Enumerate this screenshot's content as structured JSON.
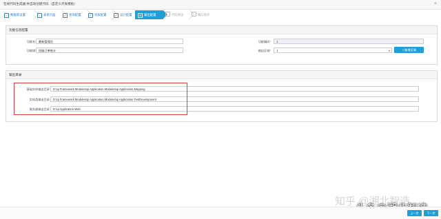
{
  "window": {
    "title": "在线代码生成器 并自动创建代码（自定义开发模板）",
    "close": "×"
  },
  "steps": [
    {
      "label": "数据库设置"
    },
    {
      "label": "表单页面"
    },
    {
      "label": "查询配置"
    },
    {
      "label": "列表配置"
    },
    {
      "label": "设计配置"
    },
    {
      "label": "输出配置"
    },
    {
      "label": "代码预览"
    },
    {
      "label": "确认保存"
    }
  ],
  "function_section": {
    "title": "功能信息配置",
    "category_label": "功能名称",
    "category_value": "最新管理员",
    "desc_label": "功能描述",
    "desc_value": "班级订单统计",
    "code_label": "功能编码",
    "code_value": "1",
    "area_label": "输出区域",
    "area_value": "1",
    "add_area_button": "新增区域"
  },
  "output_section": {
    "title": "输出目录",
    "rows": [
      {
        "label": "基础实体输出目录",
        "value": "D:\\qi Framework.Modules\\qi Application.Modules\\qi Application.Mapping"
      },
      {
        "label": "实体类输出目录",
        "value": "D:\\qi Framework.Modules\\qi Application.Modules\\qi Application.TestDevelopment"
      },
      {
        "label": "服务器输出目录",
        "value": "D:\\qi Application.Web"
      }
    ]
  },
  "footer": {
    "prev_button": "上一步",
    "next_button": "下一步"
  },
  "watermark": {
    "text1": "知乎 @湘北智造",
    "text2": "头条@湘北智造"
  },
  "colors": {
    "accent": "#1e9fd8",
    "highlight_box": "#e03c3c"
  }
}
